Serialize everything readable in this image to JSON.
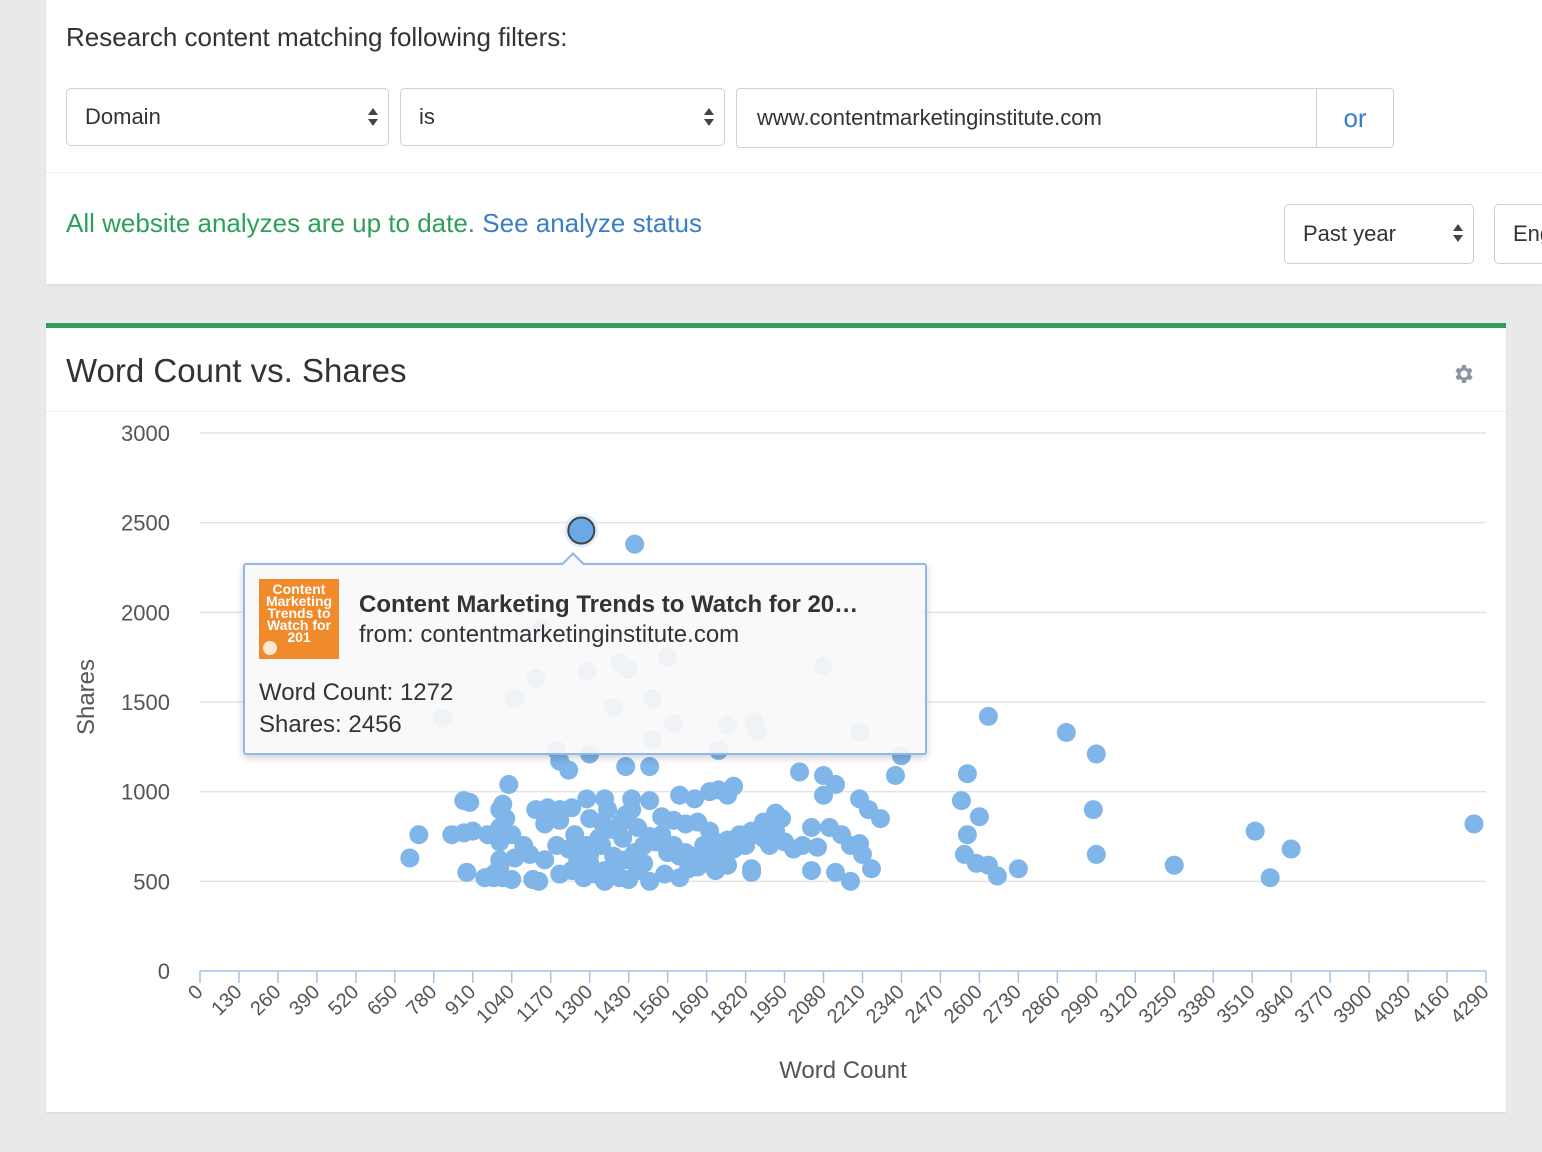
{
  "filters": {
    "heading": "Research content matching following filters:",
    "field_select": "Domain",
    "operator_select": "is",
    "value": "www.contentmarketinginstitute.com",
    "or_label": "or"
  },
  "status": {
    "message": "All website analyzes are up to date.",
    "link": "See analyze status",
    "period_select": "Past year",
    "language_select": "Eng"
  },
  "chart_card": {
    "title": "Word Count vs. Shares"
  },
  "tooltip": {
    "thumbnail_text": "Content Marketing Trends to Watch for 201",
    "title": "Content Marketing Trends to Watch for 20…",
    "source": "from: contentmarketinginstitute.com",
    "word_count": "Word Count: 1272",
    "shares": "Shares: 2456"
  },
  "colors": {
    "accent_green": "#2ea05a",
    "link_blue": "#3a7dc9",
    "point_blue": "#7fb5e8",
    "highlight_point": "#6aa8e6"
  },
  "chart_data": {
    "type": "scatter",
    "title": "",
    "xlabel": "Word Count",
    "ylabel": "Shares",
    "xlim": [
      0,
      4290
    ],
    "ylim": [
      0,
      3000
    ],
    "xticks": [
      0,
      130,
      260,
      390,
      520,
      650,
      780,
      910,
      1040,
      1170,
      1300,
      1430,
      1560,
      1690,
      1820,
      1950,
      2080,
      2210,
      2340,
      2470,
      2600,
      2730,
      2860,
      2990,
      3120,
      3250,
      3380,
      3510,
      3640,
      3770,
      3900,
      4030,
      4160,
      4290
    ],
    "yticks": [
      0,
      500,
      1000,
      1500,
      2000,
      2500,
      3000
    ],
    "highlighted": {
      "x": 1272,
      "y": 2456
    },
    "points": [
      [
        1450,
        2380
      ],
      [
        1140,
        1910
      ],
      [
        1400,
        1720
      ],
      [
        1560,
        1750
      ],
      [
        1430,
        1680
      ],
      [
        1290,
        1670
      ],
      [
        2080,
        1700
      ],
      [
        1120,
        1630
      ],
      [
        1050,
        1520
      ],
      [
        1510,
        1520
      ],
      [
        1380,
        1470
      ],
      [
        810,
        1410
      ],
      [
        1580,
        1380
      ],
      [
        1760,
        1370
      ],
      [
        1850,
        1390
      ],
      [
        1860,
        1340
      ],
      [
        2200,
        1330
      ],
      [
        1510,
        1290
      ],
      [
        1730,
        1230
      ],
      [
        1190,
        1230
      ],
      [
        1300,
        1210
      ],
      [
        1200,
        1170
      ],
      [
        1230,
        1120
      ],
      [
        1420,
        1140
      ],
      [
        1500,
        1140
      ],
      [
        2340,
        1200
      ],
      [
        2630,
        1420
      ],
      [
        2890,
        1330
      ],
      [
        2990,
        1210
      ],
      [
        2000,
        1110
      ],
      [
        2080,
        1090
      ],
      [
        2560,
        1100
      ],
      [
        2320,
        1090
      ],
      [
        1030,
        1040
      ],
      [
        1780,
        1030
      ],
      [
        1730,
        1010
      ],
      [
        1700,
        1000
      ],
      [
        2080,
        980
      ],
      [
        2120,
        1040
      ],
      [
        2200,
        960
      ],
      [
        2230,
        900
      ],
      [
        2270,
        850
      ],
      [
        2540,
        950
      ],
      [
        2600,
        860
      ],
      [
        2980,
        900
      ],
      [
        1920,
        880
      ],
      [
        1940,
        850
      ],
      [
        1880,
        830
      ],
      [
        1350,
        960
      ],
      [
        1440,
        960
      ],
      [
        1500,
        950
      ],
      [
        1600,
        980
      ],
      [
        1650,
        960
      ],
      [
        1760,
        980
      ],
      [
        1290,
        960
      ],
      [
        1360,
        900
      ],
      [
        1420,
        870
      ],
      [
        1440,
        900
      ],
      [
        1400,
        820
      ],
      [
        1540,
        860
      ],
      [
        1580,
        840
      ],
      [
        1620,
        820
      ],
      [
        1660,
        830
      ],
      [
        1700,
        780
      ],
      [
        1800,
        760
      ],
      [
        1840,
        780
      ],
      [
        1880,
        740
      ],
      [
        1920,
        780
      ],
      [
        1950,
        720
      ],
      [
        2040,
        800
      ],
      [
        2100,
        800
      ],
      [
        2140,
        760
      ],
      [
        2170,
        700
      ],
      [
        2200,
        710
      ],
      [
        2210,
        650
      ],
      [
        2560,
        760
      ],
      [
        2550,
        650
      ],
      [
        2590,
        600
      ],
      [
        2630,
        590
      ],
      [
        2660,
        530
      ],
      [
        2730,
        570
      ],
      [
        2990,
        650
      ],
      [
        3250,
        590
      ],
      [
        3520,
        780
      ],
      [
        3640,
        680
      ],
      [
        3570,
        520
      ],
      [
        4250,
        820
      ],
      [
        880,
        950
      ],
      [
        900,
        940
      ],
      [
        1010,
        930
      ],
      [
        1000,
        900
      ],
      [
        1020,
        850
      ],
      [
        1120,
        900
      ],
      [
        1160,
        910
      ],
      [
        1200,
        900
      ],
      [
        1240,
        910
      ],
      [
        1300,
        850
      ],
      [
        1340,
        830
      ],
      [
        1000,
        800
      ],
      [
        960,
        760
      ],
      [
        840,
        760
      ],
      [
        880,
        770
      ],
      [
        910,
        780
      ],
      [
        730,
        760
      ],
      [
        700,
        630
      ],
      [
        890,
        550
      ],
      [
        980,
        540
      ],
      [
        1010,
        520
      ],
      [
        1040,
        510
      ],
      [
        1110,
        510
      ],
      [
        1130,
        500
      ],
      [
        1200,
        540
      ],
      [
        1240,
        560
      ],
      [
        1280,
        520
      ],
      [
        1320,
        540
      ],
      [
        1350,
        500
      ],
      [
        1400,
        520
      ],
      [
        1430,
        510
      ],
      [
        1460,
        560
      ],
      [
        1500,
        500
      ],
      [
        1550,
        540
      ],
      [
        1600,
        520
      ],
      [
        1630,
        570
      ],
      [
        1680,
        600
      ],
      [
        1720,
        560
      ],
      [
        1760,
        590
      ],
      [
        1840,
        550
      ],
      [
        1840,
        570
      ],
      [
        2040,
        560
      ],
      [
        2120,
        550
      ],
      [
        2170,
        500
      ],
      [
        2240,
        570
      ],
      [
        1000,
        720
      ],
      [
        1040,
        760
      ],
      [
        1080,
        700
      ],
      [
        1100,
        650
      ],
      [
        1050,
        630
      ],
      [
        1000,
        580
      ],
      [
        1150,
        620
      ],
      [
        1190,
        700
      ],
      [
        1230,
        680
      ],
      [
        1260,
        620
      ],
      [
        1300,
        650
      ],
      [
        1340,
        700
      ],
      [
        1380,
        640
      ],
      [
        1420,
        620
      ],
      [
        1450,
        660
      ],
      [
        1480,
        700
      ],
      [
        1520,
        720
      ],
      [
        1560,
        660
      ],
      [
        1600,
        640
      ],
      [
        1640,
        640
      ],
      [
        1680,
        700
      ],
      [
        1720,
        720
      ],
      [
        1760,
        730
      ],
      [
        1790,
        700
      ],
      [
        1810,
        720
      ],
      [
        1860,
        760
      ],
      [
        1900,
        700
      ],
      [
        1980,
        680
      ],
      [
        2010,
        700
      ],
      [
        2060,
        690
      ],
      [
        1150,
        820
      ],
      [
        1200,
        840
      ],
      [
        1250,
        760
      ],
      [
        1290,
        700
      ],
      [
        1330,
        740
      ],
      [
        1370,
        790
      ],
      [
        1410,
        740
      ],
      [
        1460,
        800
      ],
      [
        1500,
        750
      ],
      [
        1540,
        760
      ],
      [
        1580,
        700
      ],
      [
        1620,
        660
      ],
      [
        1660,
        580
      ],
      [
        1700,
        620
      ],
      [
        1740,
        640
      ],
      [
        1780,
        680
      ],
      [
        1820,
        700
      ],
      [
        1000,
        620
      ],
      [
        950,
        520
      ],
      [
        980,
        520
      ],
      [
        1300,
        600
      ],
      [
        1350,
        560
      ],
      [
        1390,
        610
      ],
      [
        1480,
        600
      ]
    ]
  }
}
